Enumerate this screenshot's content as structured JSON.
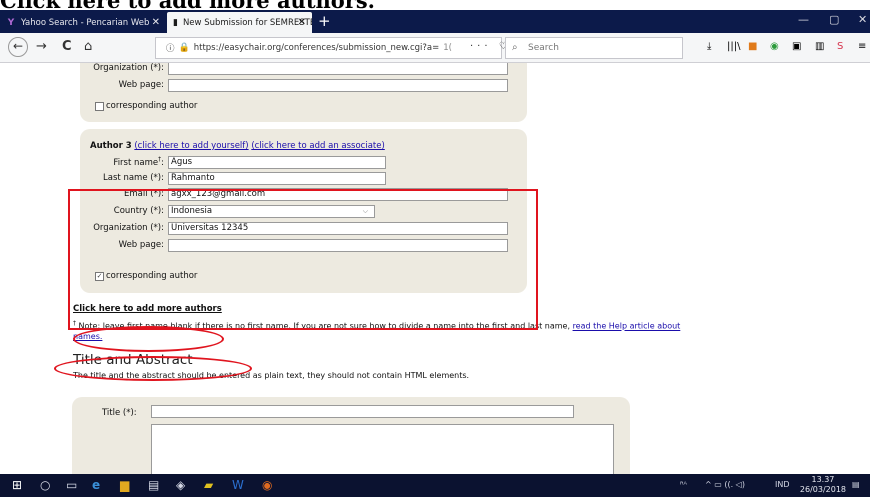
{
  "caption": "Click here to add more authors.",
  "tabs": [
    {
      "label": "Yahoo Search - Pencarian Web",
      "favicon": "Y"
    },
    {
      "label": "New Submission for SEMRESTE",
      "favicon": "▮"
    }
  ],
  "new_tab": "+",
  "window_controls": {
    "minimize": "—",
    "restore": "▢",
    "close": "✕"
  },
  "nav": {
    "back": "←",
    "forward": "→",
    "reload": "C",
    "home": "⌂"
  },
  "url": {
    "info": "ⓘ",
    "lock": "🔒",
    "text": "https://easychair.org/conferences/submission_new.cgi?a=",
    "grey": "1(",
    "page_actions": "··· ♡ ☆"
  },
  "search": {
    "placeholder": "Search",
    "icon": "search-icon"
  },
  "author_top": {
    "org_label": "Organization (*):",
    "web_label": "Web page:",
    "web_value": "",
    "corresponding": "corresponding author"
  },
  "author3": {
    "heading": "Author 3",
    "link_self": "(click here to add yourself)",
    "link_assoc": "(click here to add an associate)",
    "first_label": "First name",
    "first_sup": "†",
    "first_colon": ":",
    "first_value": "Agus",
    "last_label": "Last name (*):",
    "last_value": "Rahmanto",
    "email_label": "Email (*):",
    "email_value": "agxx_123@gmail.com",
    "country_label": "Country (*):",
    "country_value": "Indonesia",
    "org_label": "Organization (*):",
    "org_value": "Universitas 12345",
    "web_label": "Web page:",
    "web_value": "",
    "corresponding": "corresponding author",
    "corresponding_checked": true
  },
  "add_more": "Click here to add more authors",
  "note": {
    "dagger": "†",
    "text": " Note: leave first name blank if there is no first name. If you are not sure how to divide a name into the first and last name, ",
    "link": "read the Help article about names."
  },
  "title_section": {
    "heading": "Title and Abstract",
    "description": "The title and the abstract should be entered as plain text, they should not contain HTML elements.",
    "title_label": "Title (*):"
  },
  "taskbar": {
    "language": "IND",
    "time": "13.37",
    "date": "26/03/2018"
  }
}
